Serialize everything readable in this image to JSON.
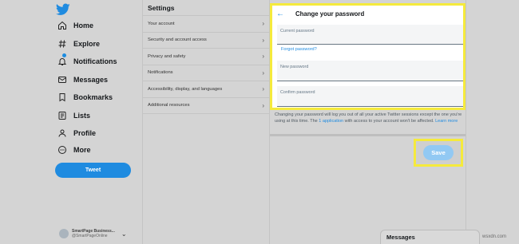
{
  "nav": {
    "items": [
      {
        "label": "Home",
        "icon": "home-icon"
      },
      {
        "label": "Explore",
        "icon": "hashtag-icon"
      },
      {
        "label": "Notifications",
        "icon": "bell-icon"
      },
      {
        "label": "Messages",
        "icon": "envelope-icon"
      },
      {
        "label": "Bookmarks",
        "icon": "bookmark-icon"
      },
      {
        "label": "Lists",
        "icon": "list-icon"
      },
      {
        "label": "Profile",
        "icon": "person-icon"
      },
      {
        "label": "More",
        "icon": "more-icon"
      }
    ],
    "tweet_label": "Tweet",
    "account": {
      "name": "SmartPage Business...",
      "handle": "@SmartPageOnline"
    }
  },
  "settings": {
    "title": "Settings",
    "items": [
      {
        "label": "Your account"
      },
      {
        "label": "Security and account access"
      },
      {
        "label": "Privacy and safety"
      },
      {
        "label": "Notifications"
      },
      {
        "label": "Accessibility, display, and languages"
      },
      {
        "label": "Additional resources"
      }
    ]
  },
  "password": {
    "title": "Change your password",
    "current_label": "Current password",
    "forgot_label": "Forgot password?",
    "new_label": "New password",
    "confirm_label": "Confirm password",
    "info_1": "Changing your password will log you out of all your active Twitter sessions except the one you're using at this time. The",
    "info_link_1": "1 application",
    "info_2": "with access to your account won't be affected.",
    "info_link_2": "Learn more",
    "save_label": "Save"
  },
  "messages_label": "Messages",
  "watermark": "wsxdn.com",
  "colors": {
    "accent": "#1f8be0",
    "highlight": "#f5ea3c",
    "dim_background": "#d4d4d4"
  }
}
